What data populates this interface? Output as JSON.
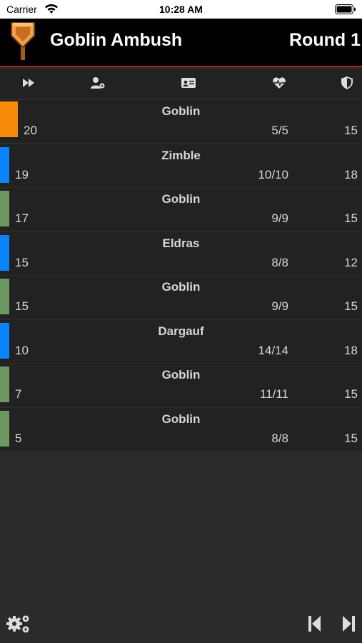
{
  "status": {
    "carrier": "Carrier",
    "time": "10:28 AM"
  },
  "header": {
    "title": "Goblin Ambush",
    "round": "Round 1"
  },
  "columns": {
    "icons": [
      "fast-forward-icon",
      "user-settings-icon",
      "id-card-icon",
      "heartbeat-icon",
      "shield-icon"
    ]
  },
  "combatants": [
    {
      "name": "Goblin",
      "initiative": "20",
      "hp": "5/5",
      "ac": "15",
      "color": "#f58a07",
      "active": true
    },
    {
      "name": "Zimble",
      "initiative": "19",
      "hp": "10/10",
      "ac": "18",
      "color": "#0a84ff",
      "active": false
    },
    {
      "name": "Goblin",
      "initiative": "17",
      "hp": "9/9",
      "ac": "15",
      "color": "#6b9960",
      "active": false
    },
    {
      "name": "Eldras",
      "initiative": "15",
      "hp": "8/8",
      "ac": "12",
      "color": "#0a84ff",
      "active": false
    },
    {
      "name": "Goblin",
      "initiative": "15",
      "hp": "9/9",
      "ac": "15",
      "color": "#6b9960",
      "active": false
    },
    {
      "name": "Dargauf",
      "initiative": "10",
      "hp": "14/14",
      "ac": "18",
      "color": "#0a84ff",
      "active": false
    },
    {
      "name": "Goblin",
      "initiative": "7",
      "hp": "11/11",
      "ac": "15",
      "color": "#6b9960",
      "active": false
    },
    {
      "name": "Goblin",
      "initiative": "5",
      "hp": "8/8",
      "ac": "15",
      "color": "#6b9960",
      "active": false
    }
  ],
  "footer": {
    "icons": [
      "settings-gears-icon",
      "previous-turn-icon",
      "next-turn-icon"
    ]
  },
  "colors": {
    "accent": "#b22222",
    "active": "#f58a07",
    "player": "#0a84ff",
    "monster": "#6b9960"
  }
}
